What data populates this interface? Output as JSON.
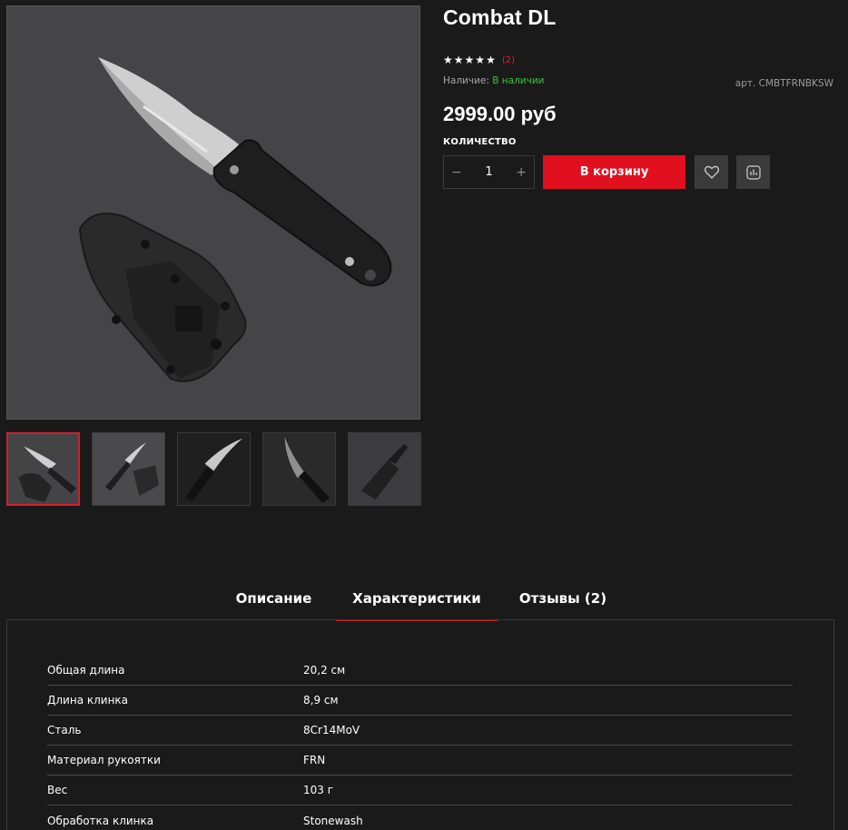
{
  "product": {
    "title": "Combat DL",
    "rating_stars": 5,
    "rating_count": "(2)",
    "availability_label": "Наличие:",
    "availability_value": "В наличии",
    "sku": "арт. CMBTFRNBKSW",
    "price": "2999.00 руб",
    "quantity_label": "КОЛИЧЕСТВО",
    "quantity_value": "1",
    "minus": "−",
    "plus": "+",
    "add_to_cart": "В корзину"
  },
  "icons": {
    "star": "star-icon",
    "favorite": "heart-icon",
    "compare": "compare-chart-icon"
  },
  "colors": {
    "accent": "#e0101e",
    "available": "#3cc13c",
    "background": "#1b1a1a"
  },
  "gallery": {
    "thumbnails_count": 5,
    "active_index": 0
  },
  "tabs": [
    {
      "label": "Описание"
    },
    {
      "label": "Характеристики",
      "active": true
    },
    {
      "label": "Отзывы (2)"
    }
  ],
  "specs": [
    {
      "name": "Общая длина",
      "value": "20,2 см"
    },
    {
      "name": "Длина клинка",
      "value": "8,9 см"
    },
    {
      "name": "Сталь",
      "value": "8Cr14MoV"
    },
    {
      "name": "Материал рукоятки",
      "value": "FRN"
    },
    {
      "name": "Вес",
      "value": "103 г"
    },
    {
      "name": "Обработка клинка",
      "value": "Stonewash"
    }
  ]
}
